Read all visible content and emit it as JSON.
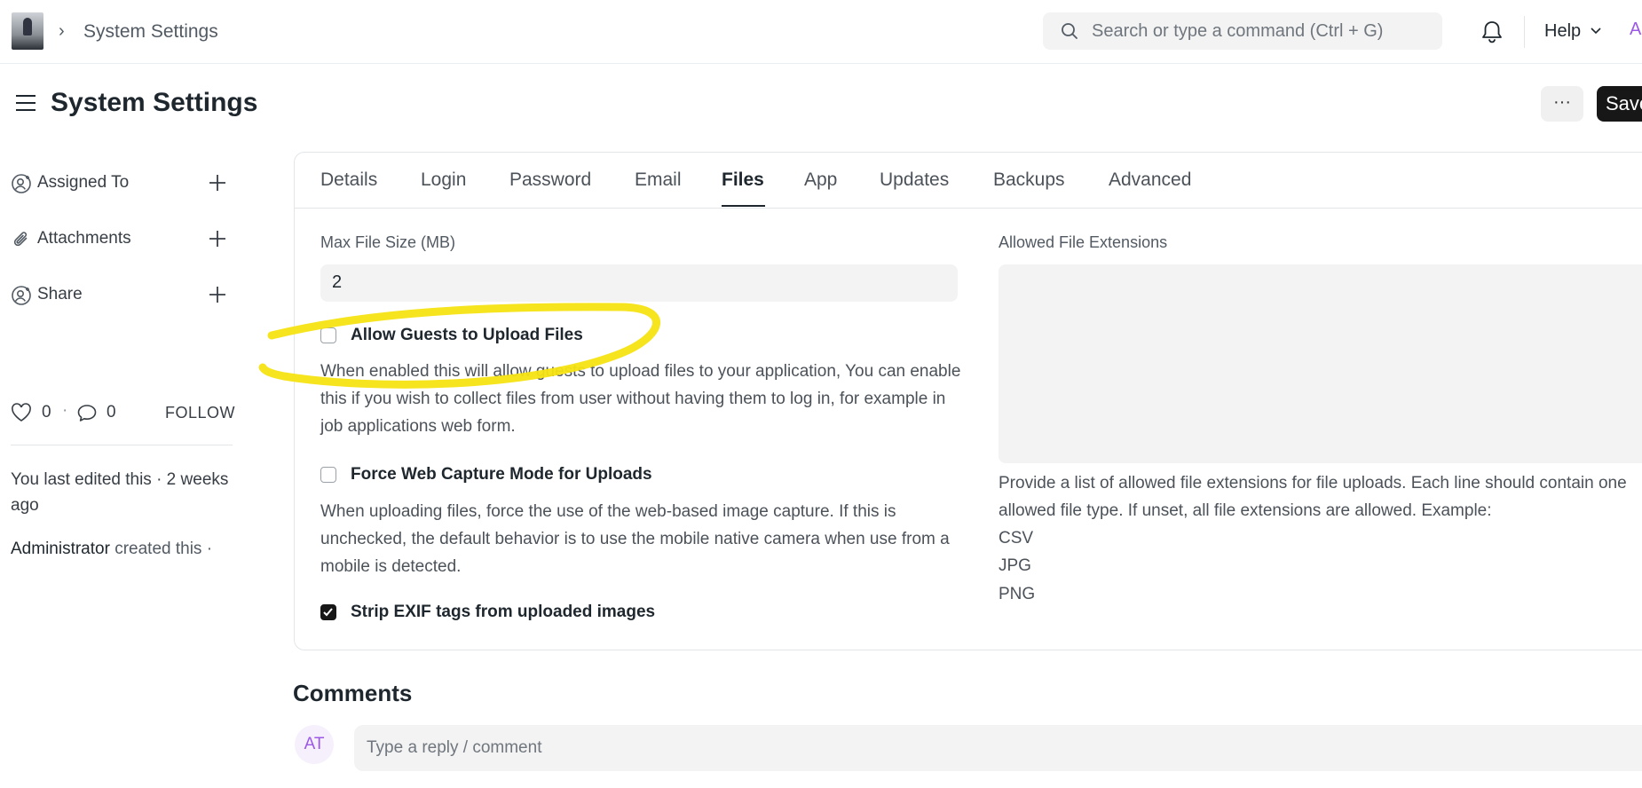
{
  "topbar": {
    "breadcrumb": "System Settings",
    "search_placeholder": "Search or type a command (Ctrl + G)",
    "help_label": "Help",
    "avatar_initial": "A"
  },
  "header": {
    "title": "System Settings",
    "more_label": "···",
    "save_label": "Save"
  },
  "sidebar": {
    "items": [
      {
        "label": "Assigned To",
        "icon": "user-plus-icon"
      },
      {
        "label": "Attachments",
        "icon": "paperclip-icon"
      },
      {
        "label": "Share",
        "icon": "share-user-icon"
      }
    ],
    "likes": "0",
    "comments_count": "0",
    "follow_label": "FOLLOW",
    "last_edited": "You last edited this · 2 weeks ago",
    "created_by": "Administrator",
    "created_text": "created this ·"
  },
  "tabs": [
    "Details",
    "Login",
    "Password",
    "Email",
    "Files",
    "App",
    "Updates",
    "Backups",
    "Advanced"
  ],
  "active_tab": "Files",
  "files": {
    "max_file_size_label": "Max File Size (MB)",
    "max_file_size_value": "2",
    "allow_guests_label": "Allow Guests to Upload Files",
    "allow_guests_checked": false,
    "allow_guests_desc": "When enabled this will allow guests to upload files to your application, You can enable this if you wish to collect files from user without having them to log in, for example in job applications web form.",
    "force_web_capture_label": "Force Web Capture Mode for Uploads",
    "force_web_capture_checked": false,
    "force_web_capture_desc": "When uploading files, force the use of the web-based image capture. If this is unchecked, the default behavior is to use the mobile native camera when use from a mobile is detected.",
    "strip_exif_label": "Strip EXIF tags from uploaded images",
    "strip_exif_checked": true,
    "allowed_ext_label": "Allowed File Extensions",
    "allowed_ext_desc": "Provide a list of allowed file extensions for file uploads. Each line should contain one allowed file type. If unset, all file extensions are allowed. Example:",
    "allowed_ext_examples": [
      "CSV",
      "JPG",
      "PNG"
    ]
  },
  "comments": {
    "title": "Comments",
    "avatar_initials": "AT",
    "placeholder": "Type a reply / comment"
  },
  "colors": {
    "annotation": "#f5e312",
    "accent_purple": "#9b59e6",
    "primary_button": "#171717"
  }
}
